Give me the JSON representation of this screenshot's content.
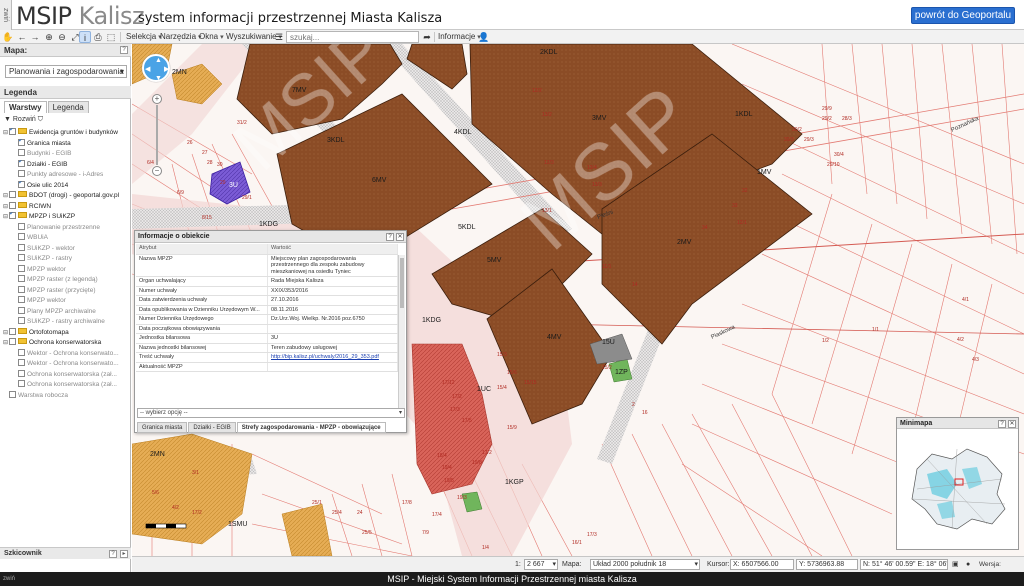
{
  "header": {
    "side_tab": "zwiń",
    "logo_main": "MSIP",
    "logo_accent": "Kalisz",
    "subtitle": "system informacji przestrzennej Miasta Kalisza",
    "portal_button": "powrót do Geoportalu"
  },
  "toolbar": {
    "menus": [
      "Selekcja",
      "Narzędzia",
      "Okna",
      "Wyszukiwanie",
      "Informacje"
    ],
    "search_placeholder": "szukaj..."
  },
  "left_panel": {
    "map_header": "Mapa:",
    "map_select": "Planowania i zagospodarowania prze",
    "legend_header": "Legenda",
    "tabs": [
      "Warstwy",
      "Legenda"
    ],
    "expand_label": "Rozwiń",
    "layers": [
      {
        "label": "Ewidencja gruntów i budynków",
        "checked": true,
        "folder": true,
        "dim": false,
        "level": 0
      },
      {
        "label": "Granica miasta",
        "checked": true,
        "folder": false,
        "dim": false,
        "level": 1
      },
      {
        "label": "Budynki - EGIB",
        "checked": false,
        "folder": false,
        "dim": true,
        "level": 1
      },
      {
        "label": "Działki - EGIB",
        "checked": true,
        "folder": false,
        "dim": false,
        "level": 1
      },
      {
        "label": "Punkty adresowe - i-Adres",
        "checked": false,
        "folder": false,
        "dim": true,
        "level": 1
      },
      {
        "label": "Osie ulic 2014",
        "checked": true,
        "folder": false,
        "dim": false,
        "level": 1
      },
      {
        "label": "BDOT (drogi) - geoportal.gov.pl",
        "checked": false,
        "folder": true,
        "dim": false,
        "level": 0
      },
      {
        "label": "RCIWN",
        "checked": false,
        "folder": true,
        "dim": false,
        "level": 0
      },
      {
        "label": "MPZP i SUiKZP",
        "checked": true,
        "folder": true,
        "dim": false,
        "level": 0
      },
      {
        "label": "Planowanie przestrzenne",
        "checked": false,
        "folder": false,
        "dim": true,
        "level": 1
      },
      {
        "label": "WBUiA",
        "checked": false,
        "folder": false,
        "dim": true,
        "level": 1
      },
      {
        "label": "SUiKZP - wektor",
        "checked": false,
        "folder": false,
        "dim": true,
        "level": 1
      },
      {
        "label": "SUiKZP - rastry",
        "checked": false,
        "folder": false,
        "dim": true,
        "level": 1
      },
      {
        "label": "MPZP wektor",
        "checked": false,
        "folder": false,
        "dim": true,
        "level": 1
      },
      {
        "label": "MPZP raster (z legendą)",
        "checked": false,
        "folder": false,
        "dim": true,
        "level": 1
      },
      {
        "label": "MPZP raster (przycięte)",
        "checked": false,
        "folder": false,
        "dim": true,
        "level": 1
      },
      {
        "label": "MPZP wektor",
        "checked": false,
        "folder": false,
        "dim": true,
        "level": 1
      },
      {
        "label": "Plany MPZP archiwalne",
        "checked": false,
        "folder": false,
        "dim": true,
        "level": 1
      },
      {
        "label": "SUiKZP - rastry archiwalne",
        "checked": false,
        "folder": false,
        "dim": true,
        "level": 1
      },
      {
        "label": "Ortofotomapa",
        "checked": false,
        "folder": true,
        "dim": false,
        "level": 0
      },
      {
        "label": "Ochrona konserwatorska",
        "checked": false,
        "folder": true,
        "dim": false,
        "level": 0
      },
      {
        "label": "Wektor - Ochrona konserwato...",
        "checked": false,
        "folder": false,
        "dim": true,
        "level": 1
      },
      {
        "label": "Wektor - Ochrona konserwato...",
        "checked": false,
        "folder": false,
        "dim": true,
        "level": 1
      },
      {
        "label": "Ochrona konserwatorska (zał...",
        "checked": false,
        "folder": false,
        "dim": true,
        "level": 1
      },
      {
        "label": "Ochrona konserwatorska (zał...",
        "checked": false,
        "folder": false,
        "dim": true,
        "level": 1
      },
      {
        "label": "Warstwa robocza",
        "checked": false,
        "folder": false,
        "dim": true,
        "level": 0
      }
    ],
    "bottom_header": "Szkicownik"
  },
  "map": {
    "watermark": "MSIP",
    "zones": [
      "7MV",
      "6MV",
      "3MV",
      "5MV",
      "2MV",
      "4MV",
      "1MV",
      "2KDL",
      "3KDL",
      "4KDL",
      "1KDL",
      "5KDL",
      "1KDG",
      "1KDG",
      "1ZP",
      "15U",
      "3U",
      "2MN",
      "2MN",
      "1UC",
      "1SMU",
      "1KGP"
    ],
    "parcels": [
      "30/1",
      "31/2",
      "13/2",
      "12/2",
      "13/4",
      "13/3",
      "12/3",
      "32",
      "33",
      "34",
      "13/1",
      "11/1",
      "12/1",
      "14",
      "1/1",
      "4/1",
      "4/2",
      "4/3",
      "2",
      "1/2",
      "30",
      "29",
      "29/1",
      "28",
      "27",
      "26",
      "30/2",
      "30/3",
      "29/3",
      "29/2",
      "29/9",
      "28/3",
      "30/4",
      "29/10",
      "8/15",
      "6/9",
      "17/12",
      "17/2",
      "17/3",
      "17/5",
      "18/4",
      "19/3",
      "19/4",
      "19/5",
      "19/8",
      "17/2",
      "15/4",
      "15/3",
      "15/9",
      "15/6",
      "15/15",
      "15/2",
      "16",
      "25/1",
      "25/4",
      "24",
      "25/5",
      "17/8",
      "17/4",
      "7/9",
      "5/6",
      "4/2",
      "1/4",
      "17/2",
      "16/1",
      "17/3",
      "3/1",
      "6/4"
    ],
    "street_labels": [
      "Poznańska",
      "Pieśni",
      "Piaskowa"
    ]
  },
  "infowin": {
    "title": "Informacje o obiekcie",
    "col_attr": "Atrybut",
    "col_val": "Wartość",
    "rows": [
      {
        "attr": "Nazwa MPZP",
        "val": "Miejscowy plan zagospodarowania przestrzennego dla zespołu zabudowy mieszkaniowej na osiedlu Tyniec"
      },
      {
        "attr": "Organ uchwalający",
        "val": "Rada Miejska Kalisza"
      },
      {
        "attr": "Numer uchwały",
        "val": "XXIX/353/2016"
      },
      {
        "attr": "Data zatwierdzenia uchwały",
        "val": "27.10.2016"
      },
      {
        "attr": "Data opublikowania w Dzienniku Urzędowym W...",
        "val": "08.11.2016"
      },
      {
        "attr": "Numer Dziennika Urzędowego",
        "val": "Dz.Urz.Woj. Wielkp. Nr.2016 poz.6750"
      },
      {
        "attr": "Data początkowa obowiązywania",
        "val": ""
      },
      {
        "attr": "Jednostka bilansowa",
        "val": "3U"
      },
      {
        "attr": "Nazwa jednostki bilansowej",
        "val": "Teren zabudowy usługowej"
      },
      {
        "attr": "Treść uchwały",
        "val": "http://bip.kalisz.pl/uchwaly/2016_29_353.pdf",
        "link": true
      },
      {
        "attr": "Aktualność MPZP",
        "val": ""
      }
    ],
    "select_placeholder": "-- wybierz opcję --",
    "tabs": [
      "Granica miasta",
      "Działki - EGIB",
      "Strefy zagospodarowania - MPZP - obowiązujące"
    ]
  },
  "minimap": {
    "title": "Minimapa"
  },
  "statusbar": {
    "scale_prefix": "1:",
    "scale": "2 667",
    "map_label": "Mapa:",
    "crs": "Układ 2000 południk 18",
    "cursor_label": "Kursor:",
    "x_coord": "X: 6507566.00",
    "y_coord": "Y: 5736963.88",
    "latlon": "N: 51° 46' 00.59\" E: 18° 06' 34.58\"",
    "version": "Wersja: 8.0.521"
  },
  "footer": {
    "tab": "zwiń",
    "text": "MSIP - Miejski System Informacji Przestrzennej miasta Kalisza"
  },
  "colors": {
    "zone_brown": "#8b4c26",
    "zone_red": "#d24a40",
    "zone_orange": "#e4a545",
    "zone_purple": "#7b5cd6",
    "zone_green": "#70b55c",
    "road_light": "#f2dcd8",
    "portal_blue": "#2a6fd0"
  }
}
